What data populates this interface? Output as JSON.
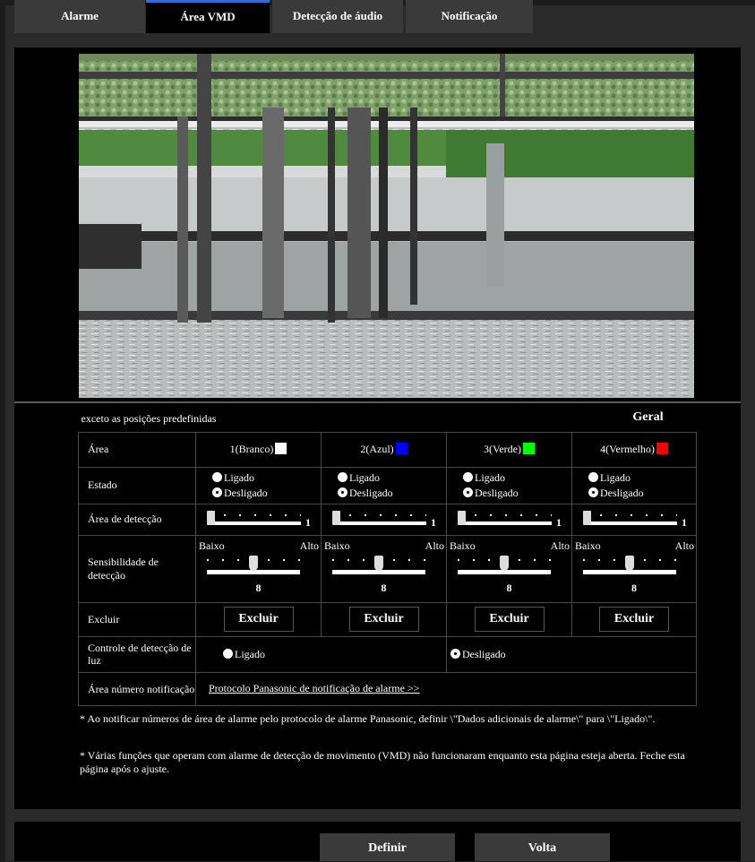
{
  "tabs": [
    {
      "label": "Alarme"
    },
    {
      "label": "Área VMD",
      "active": true
    },
    {
      "label": "Detecção de áudio"
    },
    {
      "label": "Notificação"
    }
  ],
  "preset": {
    "label": "exceto as posições predefinidas",
    "button": "Geral"
  },
  "rows": {
    "area": "Área",
    "estado": "Estado",
    "area_deteccao": "Área de detecção",
    "sensibilidade": "Sensibilidade de detecção",
    "excluir": "Excluir",
    "controle_luz": "Controle de detecção de luz",
    "area_numero": "Área número notificação"
  },
  "areas": [
    {
      "name": "1(Branco)",
      "color": "#ffffff"
    },
    {
      "name": "2(Azul)",
      "color": "#0000ff"
    },
    {
      "name": "3(Verde)",
      "color": "#00ff00"
    },
    {
      "name": "4(Vermelho)",
      "color": "#ff0000"
    }
  ],
  "estado": {
    "on": "Ligado",
    "off": "Desligado",
    "selected": "off"
  },
  "detection_area_value": "1",
  "sensitivity": {
    "low": "Baixo",
    "high": "Alto",
    "value": "8"
  },
  "excluir_button": "Excluir",
  "light_control": {
    "on": "Ligado",
    "off": "Desligado",
    "selected": "off"
  },
  "notification_link": "Protocolo Panasonic de notificação de alarme >>",
  "notes": [
    "* Ao notificar números de área de alarme pelo protocolo de alarme Panasonic, definir \\\"Dados adicionais de alarme\\\" para \\\"Ligado\\\".",
    "* Várias funções que operam com alarme de detecção de movimento (VMD) não funcionaram enquanto esta página esteja aberta. Feche esta página após o ajuste."
  ],
  "footer": {
    "definir": "Definir",
    "volta": "Volta"
  }
}
